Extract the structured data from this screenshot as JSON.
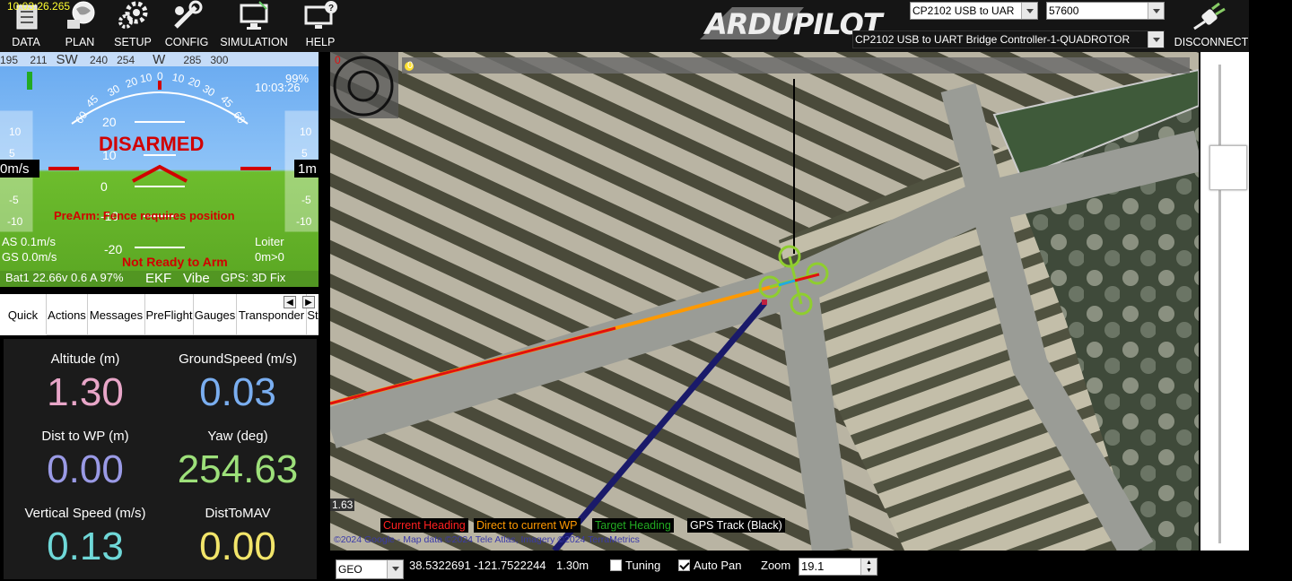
{
  "clock": "10:03:26.265",
  "menu": [
    {
      "label": "DATA",
      "icon": "data-icon"
    },
    {
      "label": "PLAN",
      "icon": "plan-icon"
    },
    {
      "label": "SETUP",
      "icon": "setup-icon"
    },
    {
      "label": "CONFIG",
      "icon": "config-icon"
    },
    {
      "label": "SIMULATION",
      "icon": "simulation-icon"
    },
    {
      "label": "HELP",
      "icon": "help-icon"
    }
  ],
  "logo_text": "ARDUPILOT",
  "connection": {
    "port": "CP2102 USB to UAR",
    "baud": "57600",
    "device": "CP2102 USB to UART Bridge Controller-1-QUADROTOR",
    "disconnect_label": "DISCONNECT"
  },
  "hud": {
    "compass": [
      "195",
      "211",
      "SW",
      "240",
      "254",
      "W",
      "285",
      "300"
    ],
    "time": "10:03:26",
    "battery_percent": "99%",
    "status": "DISARMED",
    "prearm": "PreArm: Fence requires position",
    "not_ready": "Not Ready to Arm",
    "airspeed": "AS 0.1m/s",
    "groundspeed": "GS 0.0m/s",
    "mode": "Loiter",
    "wp_info": "0m>0",
    "battery": "Bat1 22.66v 0.6 A 97%",
    "ekf": "EKF",
    "vibe": "Vibe",
    "gps": "GPS: 3D Fix",
    "speed_left": "0m/s",
    "alt_right": "1m",
    "pitch_labels": [
      "20",
      "10",
      "0",
      "-10",
      "-20"
    ],
    "roll_labels": [
      "60",
      "45",
      "30",
      "20",
      "10",
      "0",
      "10",
      "20",
      "30",
      "45",
      "60"
    ],
    "left_tape": [
      "10",
      "5",
      "0",
      "-5",
      "-10"
    ],
    "right_tape": [
      "10",
      "5",
      "0",
      "-5",
      "-10"
    ]
  },
  "tabs": [
    "Quick",
    "Actions",
    "Messages",
    "PreFlight",
    "Gauges",
    "Transponder",
    "St"
  ],
  "quick": [
    {
      "label": "Altitude (m)",
      "value": "1.30",
      "color": "#e8a6c8"
    },
    {
      "label": "GroundSpeed (m/s)",
      "value": "0.03",
      "color": "#7aaef0"
    },
    {
      "label": "Dist to WP (m)",
      "value": "0.00",
      "color": "#9a9ae6"
    },
    {
      "label": "Yaw (deg)",
      "value": "254.63",
      "color": "#9de07a"
    },
    {
      "label": "Vertical Speed (m/s)",
      "value": "0.13",
      "color": "#6fd8d8"
    },
    {
      "label": "DistToMAV",
      "value": "0.00",
      "color": "#f2e56a"
    }
  ],
  "map": {
    "scale_left": "0",
    "scale_right": "0",
    "scale_value": "1.63",
    "legend": [
      {
        "label": "Current Heading",
        "color": "#ff2020"
      },
      {
        "label": "Direct to current WP",
        "color": "#ff9900"
      },
      {
        "label": "Target Heading",
        "color": "#22aa22"
      },
      {
        "label": "GPS Track (Black)",
        "color": "#ffffff"
      }
    ],
    "copyright": "©2024 Google - Map data ©2024 Tele Atlas, Imagery ©2024 TerraMetrics"
  },
  "statusbar": {
    "coord_type": "GEO",
    "coords": "38.5322691 -121.7522244",
    "alt": "1.30m",
    "tuning_label": "Tuning",
    "autopan_label": "Auto Pan",
    "zoom_label": "Zoom",
    "zoom_value": "19.1"
  }
}
